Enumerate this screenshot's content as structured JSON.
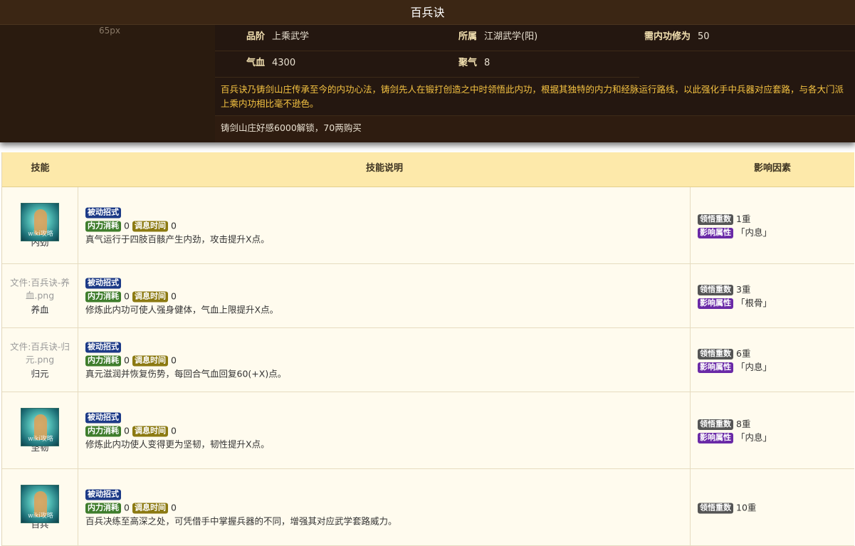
{
  "title": "百兵诀",
  "image_placeholder": "65px",
  "attrs": {
    "grade_label": "品阶",
    "grade": "上乘武学",
    "belong_label": "所属",
    "belong": "江湖武学(阳)",
    "req_label": "需内功修为",
    "req": "50",
    "hp_label": "气血",
    "hp": "4300",
    "qi_label": "聚气",
    "qi": "8"
  },
  "description": "百兵诀乃铸剑山庄传承至今的内功心法，铸剑先人在锻打创造之中时领悟此内功，根据其独特的内力和经脉运行路线，以此强化手中兵器对应套路，与各大门派上乘内功相比毫不逊色。",
  "unlock": "铸剑山庄好感6000解锁，70两购买",
  "table": {
    "headers": [
      "技能",
      "技能说明",
      "影响因素"
    ],
    "badges": {
      "passive": "被动招式",
      "mp": "内力消耗",
      "cd": "调息时间",
      "rank": "领悟重数",
      "attr": "影响属性"
    },
    "rows": [
      {
        "icon": "neijin-icon",
        "watermark": "wiki攻略",
        "file": "",
        "name": "内劲",
        "mp": "0",
        "cd": "0",
        "text": "真气运行于四肢百骸产生内劲，攻击提升X点。",
        "rank": "1重",
        "attr": "「内息」"
      },
      {
        "icon": "",
        "watermark": "",
        "file": "文件:百兵诀-养血.png",
        "name": "养血",
        "mp": "0",
        "cd": "0",
        "text": "修炼此内功可使人强身健体，气血上限提升X点。",
        "rank": "3重",
        "attr": "「根骨」"
      },
      {
        "icon": "",
        "watermark": "",
        "file": "文件:百兵诀-归元.png",
        "name": "归元",
        "mp": "0",
        "cd": "0",
        "text": "真元滋润并恢复伤势，每回合气血回复60(+X)点。",
        "rank": "6重",
        "attr": "「内息」"
      },
      {
        "icon": "jianren-icon",
        "watermark": "wiki攻略",
        "file": "",
        "name": "坚韧",
        "mp": "0",
        "cd": "0",
        "text": "修炼此内功使人变得更为坚韧，韧性提升X点。",
        "rank": "8重",
        "attr": "「内息」"
      },
      {
        "icon": "baibing-icon",
        "watermark": "wiki攻略",
        "file": "",
        "name": "百兵",
        "mp": "0",
        "cd": "0",
        "text": "百兵决练至高深之处，可凭借手中掌握兵器的不同，增强其对应武学套路威力。",
        "rank": "10重",
        "attr": ""
      }
    ]
  }
}
